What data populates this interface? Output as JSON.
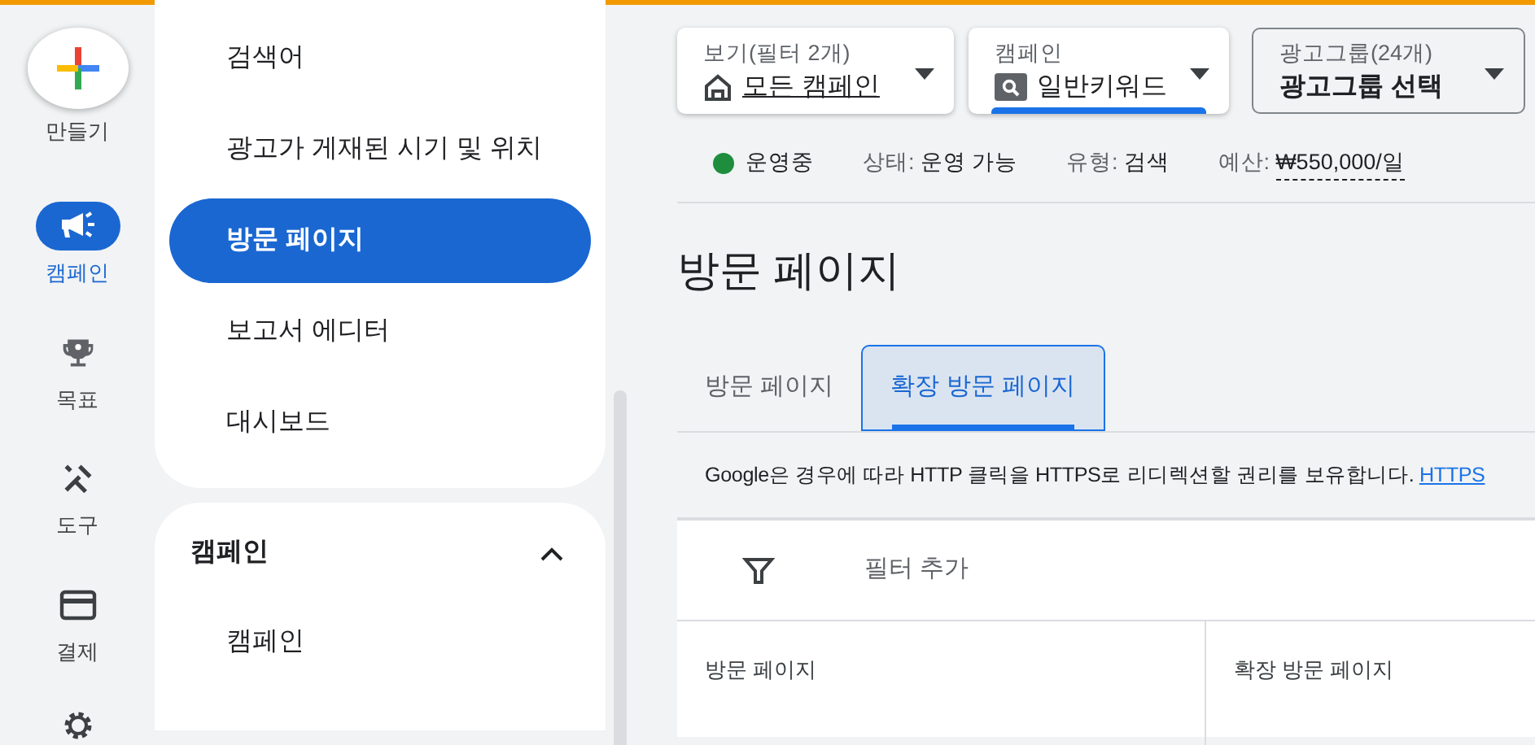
{
  "rail": {
    "create_label": "만들기",
    "items": [
      {
        "label": "캠페인",
        "selected": true
      },
      {
        "label": "목표",
        "selected": false
      },
      {
        "label": "도구",
        "selected": false
      },
      {
        "label": "결제",
        "selected": false
      }
    ]
  },
  "nav": {
    "items": [
      {
        "label": "검색어",
        "selected": false
      },
      {
        "label": "광고가 게재된 시기 및 위치",
        "selected": false
      },
      {
        "label": "방문 페이지",
        "selected": true
      },
      {
        "label": "보고서 에디터",
        "selected": false
      },
      {
        "label": "대시보드",
        "selected": false
      }
    ],
    "section": {
      "title": "캠페인",
      "expanded": true,
      "items": [
        {
          "label": "캠페인",
          "selected": false
        }
      ]
    }
  },
  "pickers": [
    {
      "label": "보기(필터 2개)",
      "value": "모든 캠페인",
      "kind": "view"
    },
    {
      "label": "캠페인",
      "value": "일반키워드",
      "kind": "campaign"
    },
    {
      "label": "광고그룹(24개)",
      "value": "광고그룹 선택",
      "kind": "adgroup"
    }
  ],
  "status": {
    "state": "운영중",
    "color": "#1e8e3e",
    "fields": [
      {
        "label": "상태:",
        "value": "운영 가능"
      },
      {
        "label": "유형:",
        "value": "검색"
      },
      {
        "label": "예산:",
        "value": "₩550,000/일"
      }
    ]
  },
  "page_title": "방문 페이지",
  "tabs": [
    {
      "label": "방문 페이지",
      "selected": false
    },
    {
      "label": "확장 방문 페이지",
      "selected": true
    }
  ],
  "notice": {
    "text": "Google은 경우에 따라 HTTP 클릭을 HTTPS로 리디렉션할 권리를 보유합니다.",
    "link": "HTTPS"
  },
  "filter": {
    "label": "필터 추가"
  },
  "table": {
    "columns": [
      "방문 페이지",
      "확장 방문 페이지"
    ]
  }
}
